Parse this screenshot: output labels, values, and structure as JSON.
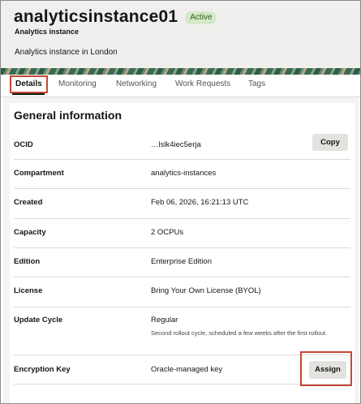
{
  "header": {
    "title": "analyticsinstance01",
    "status": "Active",
    "type": "Analytics instance",
    "description": "Analytics instance in London"
  },
  "tabs": [
    {
      "label": "Details",
      "active": true
    },
    {
      "label": "Monitoring",
      "active": false
    },
    {
      "label": "Networking",
      "active": false
    },
    {
      "label": "Work Requests",
      "active": false
    },
    {
      "label": "Tags",
      "active": false
    }
  ],
  "general_info": {
    "title": "General information",
    "rows": [
      {
        "label": "OCID",
        "value": "…lslk4iec5erja",
        "action": "Copy"
      },
      {
        "label": "Compartment",
        "value": "analytics-instances"
      },
      {
        "label": "Created",
        "value": "Feb 06, 2026, 16:21:13 UTC"
      },
      {
        "label": "Capacity",
        "value": "2 OCPUs"
      },
      {
        "label": "Edition",
        "value": "Enterprise Edition"
      },
      {
        "label": "License",
        "value": "Bring Your Own License (BYOL)"
      },
      {
        "label": "Update Cycle",
        "value": "Regular",
        "note": "Second rollout cycle, scheduled a few weeks after the first rollout."
      },
      {
        "label": "Encryption Key",
        "value": "Oracle-managed key",
        "action": "Assign"
      }
    ]
  },
  "colors": {
    "status_badge_bg": "#d5e9c9",
    "highlight": "#c74634",
    "button_bg": "#e4e2df"
  }
}
